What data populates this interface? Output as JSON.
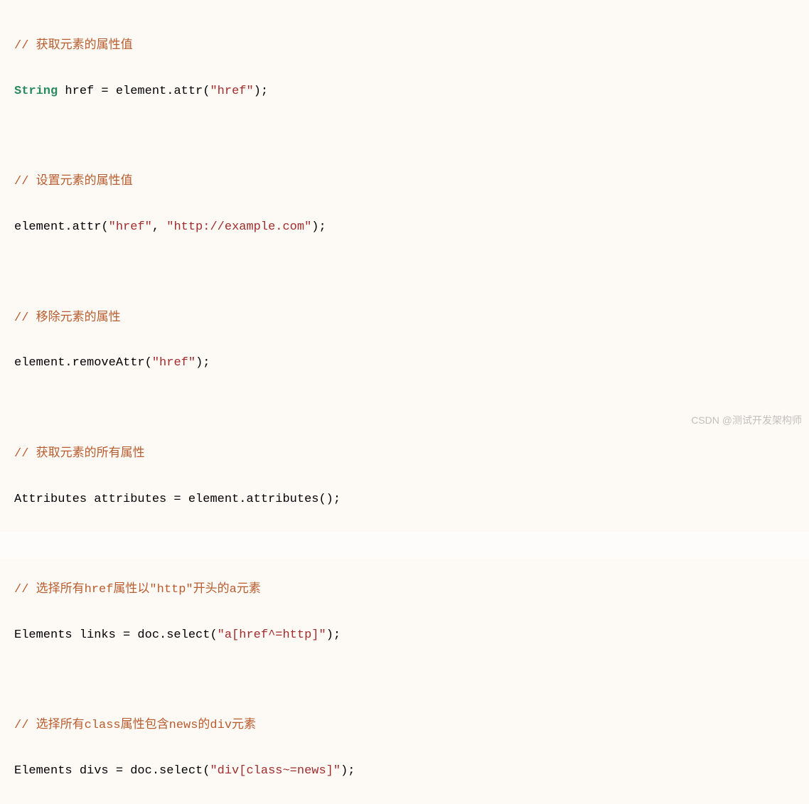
{
  "lines": {
    "c1": "// 获取元素的属性值",
    "l1_keyword": "String",
    "l1_rest": " href = element.attr(",
    "l1_str": "\"href\"",
    "l1_end": ");",
    "c2": "// 设置元素的属性值",
    "l2_start": "element.attr(",
    "l2_str1": "\"href\"",
    "l2_mid": ", ",
    "l2_str2": "\"http://example.com\"",
    "l2_end": ");",
    "c3": "// 移除元素的属性",
    "l3_start": "element.removeAttr(",
    "l3_str": "\"href\"",
    "l3_end": ");",
    "c4": "// 获取元素的所有属性",
    "l4": "Attributes attributes = element.attributes();",
    "c5": "// 选择所有href属性以\"http\"开头的a元素",
    "l5_start": "Elements links = doc.select(",
    "l5_str": "\"a[href^=http]\"",
    "l5_end": ");",
    "c6": "// 选择所有class属性包含news的div元素",
    "l6_start": "Elements divs = doc.select(",
    "l6_str": "\"div[class~=news]\"",
    "l6_end": ");"
  },
  "watermark": "CSDN @测试开发架构师"
}
